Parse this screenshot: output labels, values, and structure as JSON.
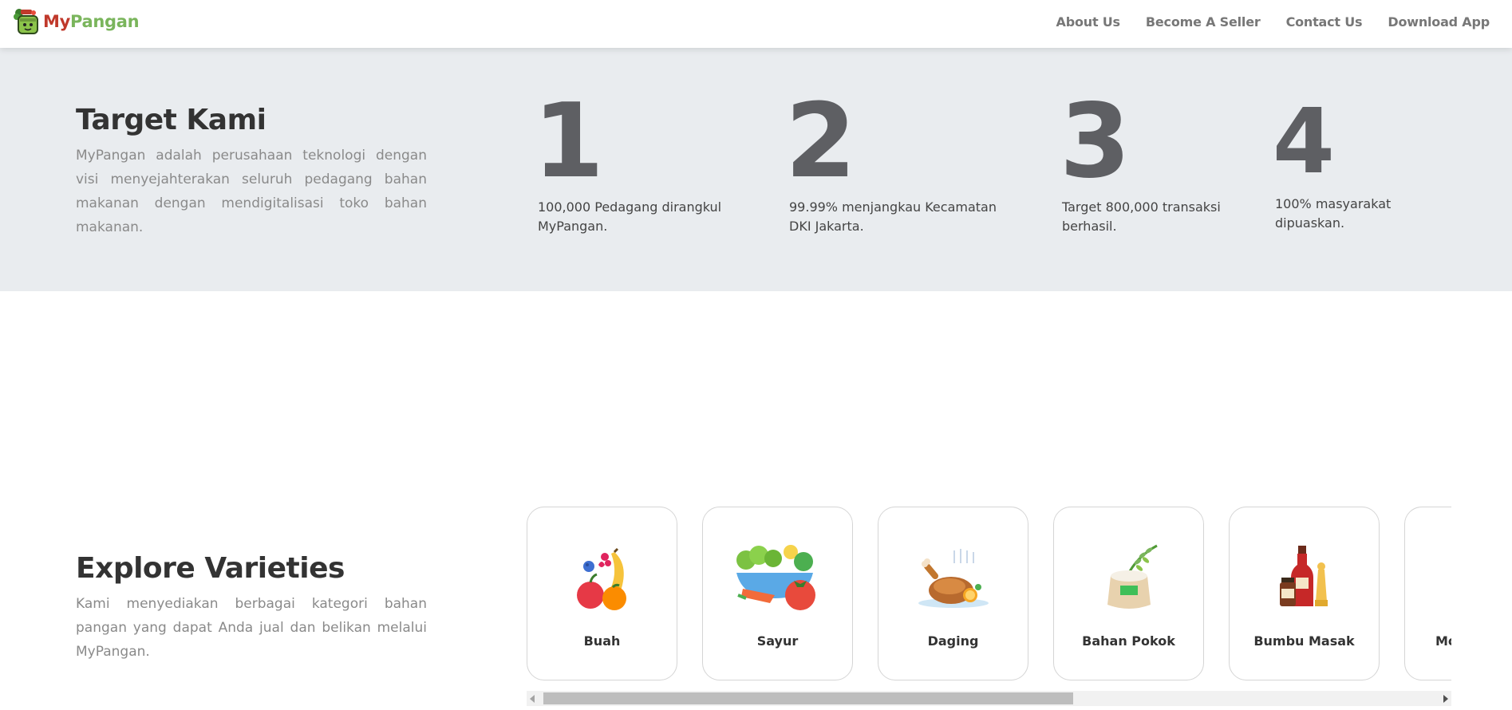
{
  "brand": {
    "part1": "My",
    "part2": "Pangan"
  },
  "nav": {
    "items": [
      "About Us",
      "Become A Seller",
      "Contact Us",
      "Download App"
    ]
  },
  "target": {
    "title": "Target Kami",
    "description": "MyPangan adalah perusahaan teknologi dengan visi menyejahterakan seluruh pedagang bahan makanan dengan mendigitalisasi toko bahan makanan.",
    "items": [
      {
        "number": "1",
        "line1": "100,000 Pedagang dirangkul",
        "line2": "MyPangan."
      },
      {
        "number": "2",
        "line1": "99.99% menjangkau Kecamatan",
        "line2": "DKI Jakarta."
      },
      {
        "number": "3",
        "line1": "Target 800,000 transaksi",
        "line2": "berhasil."
      },
      {
        "number": "4",
        "line1": "100% masyarakat",
        "line2": "dipuaskan."
      }
    ]
  },
  "explore": {
    "title": "Explore Varieties",
    "description": "Kami menyediakan berbagai kategori bahan pangan yang dapat Anda jual dan belikan melalui MyPangan.",
    "categories": [
      {
        "label": "Buah",
        "icon": "fruit-icon"
      },
      {
        "label": "Sayur",
        "icon": "vegetable-icon"
      },
      {
        "label": "Daging",
        "icon": "roast-chicken-icon"
      },
      {
        "label": "Bahan Pokok",
        "icon": "rice-sack-icon"
      },
      {
        "label": "Bumbu Masak",
        "icon": "condiment-bottles-icon"
      },
      {
        "label": "Mo",
        "icon": "partial-icon"
      }
    ]
  },
  "colors": {
    "brand_red": "#c0392b",
    "brand_green": "#7ab55c",
    "section_bg": "#e9ecef",
    "number_gray": "#5e5f63"
  }
}
